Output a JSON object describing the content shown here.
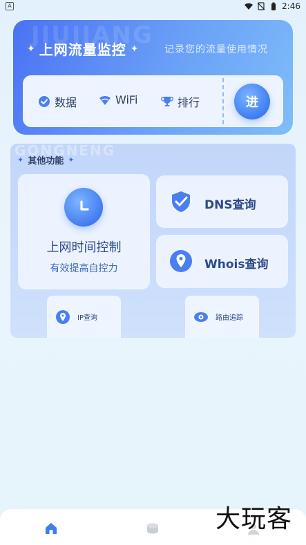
{
  "status_bar": {
    "left_badge": "A",
    "time": "2:46"
  },
  "top_card": {
    "watermark": "JIUJIANG",
    "title": "上网流量监控",
    "subtitle": "记录您的流量使用情况",
    "nav": [
      {
        "label": "数据",
        "icon": "check-circle-icon"
      },
      {
        "label": "WiFi",
        "icon": "wifi-icon"
      },
      {
        "label": "排行",
        "icon": "trophy-icon"
      }
    ],
    "enter_label": "进"
  },
  "panel": {
    "watermark": "GONGNENG",
    "title": "其他功能",
    "big_tile": {
      "title": "上网时间控制",
      "subtitle": "有效提高自控力",
      "icon": "clock-icon"
    },
    "dns_tile": {
      "label": "DNS查询",
      "icon": "shield-check-icon"
    },
    "whois_tile": {
      "label": "Whois查询",
      "icon": "location-pin-icon"
    },
    "ip_tile": {
      "label": "IP查询",
      "icon": "location-pin-icon"
    },
    "route_tile": {
      "label": "路由追踪",
      "icon": "route-icon"
    }
  },
  "bottom_bar": {
    "tabs": [
      {
        "icon": "home-icon"
      },
      {
        "icon": "box-icon"
      },
      {
        "icon": "user-icon"
      }
    ],
    "accent": "#3d7df1"
  },
  "brand_mark": "大玩客"
}
